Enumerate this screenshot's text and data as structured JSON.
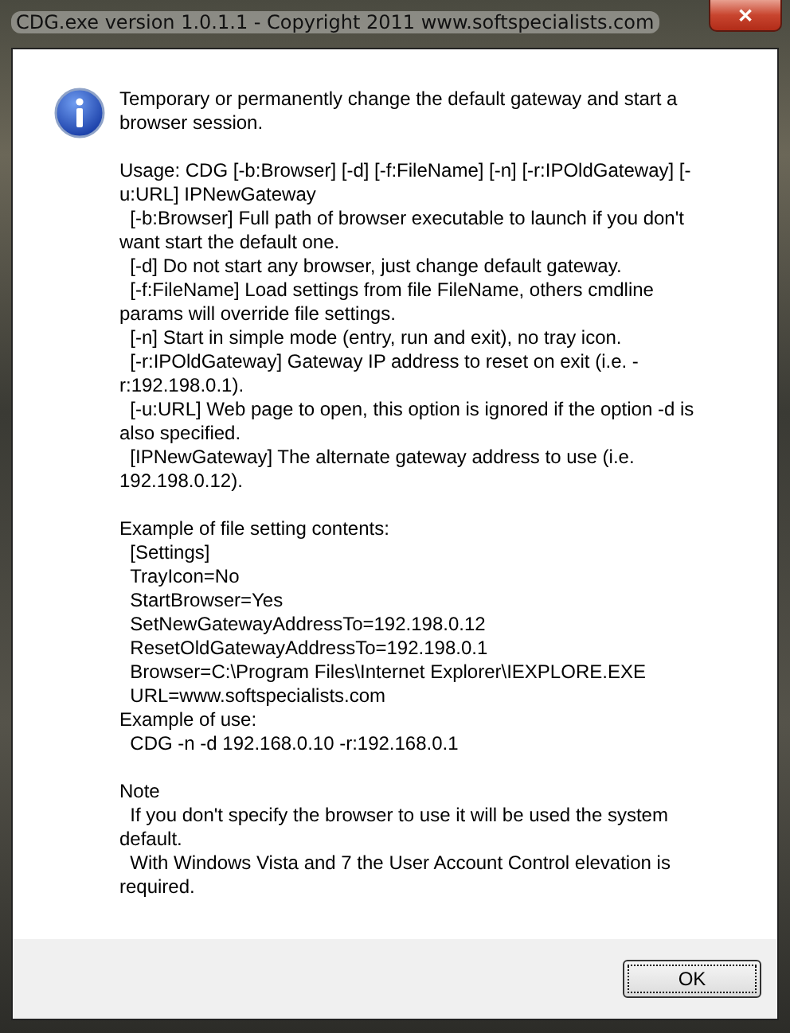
{
  "window": {
    "title": "CDG.exe version 1.0.1.1 - Copyright 2011 www.softspecialists.com",
    "close": "✕"
  },
  "message": [
    [
      "Temporary or permanently change the default gateway and start a browser session."
    ],
    [
      "Usage: CDG [-b:Browser] [-d] [-f:FileName] [-n] [-r:IPOldGateway] [-u:URL] IPNewGateway",
      "  [-b:Browser] Full path of browser executable to launch if you don't want start the default one.",
      "  [-d] Do not start any browser, just change default gateway.",
      "  [-f:FileName] Load settings from file FileName, others cmdline params will override file settings.",
      "  [-n] Start in simple mode (entry, run and exit), no tray icon.",
      "  [-r:IPOldGateway] Gateway IP address to reset on exit (i.e. -r:192.198.0.1).",
      "  [-u:URL] Web page to open, this option is ignored if the option -d is also specified.",
      "  [IPNewGateway] The alternate gateway address to use (i.e. 192.198.0.12)."
    ],
    [
      "Example of file setting contents:",
      "  [Settings]",
      "  TrayIcon=No",
      "  StartBrowser=Yes",
      "  SetNewGatewayAddressTo=192.198.0.12",
      "  ResetOldGatewayAddressTo=192.198.0.1",
      "  Browser=C:\\Program Files\\Internet Explorer\\IEXPLORE.EXE",
      "  URL=www.softspecialists.com",
      "Example of use:",
      "  CDG -n -d 192.168.0.10 -r:192.168.0.1"
    ],
    [
      "Note",
      "  If you don't specify the browser to use it will be used the system default.",
      "  With Windows Vista and 7 the User Account Control elevation is required."
    ]
  ],
  "buttons": [
    "OK"
  ]
}
